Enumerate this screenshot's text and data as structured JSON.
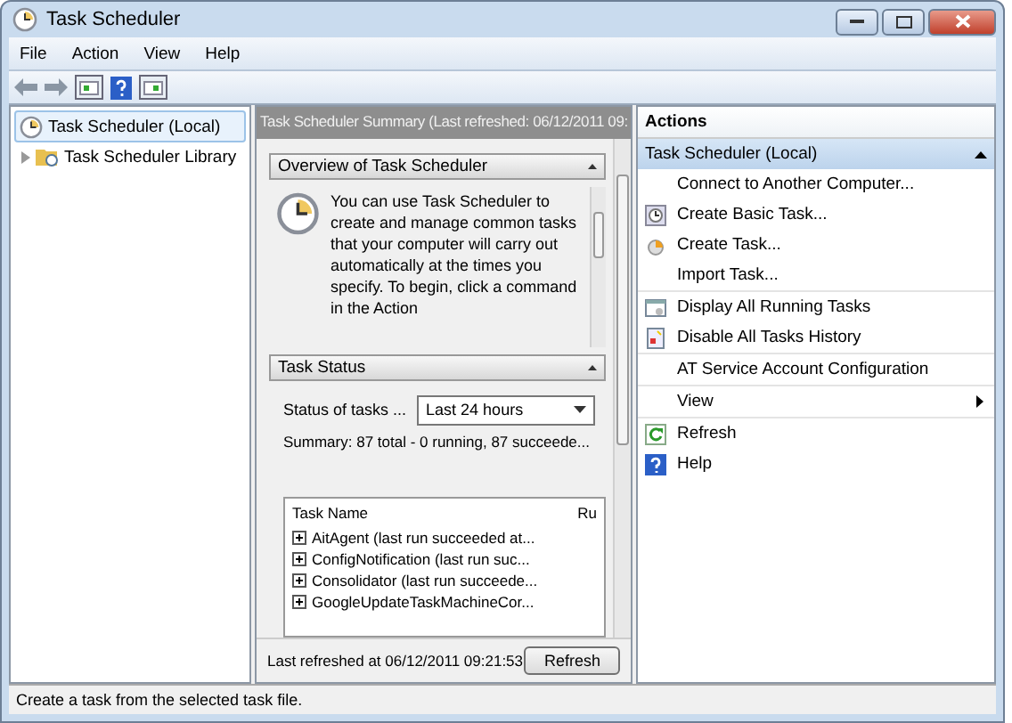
{
  "window": {
    "title": "Task Scheduler"
  },
  "menu": [
    "File",
    "Action",
    "View",
    "Help"
  ],
  "tree": [
    {
      "label": "Task Scheduler (Local)",
      "kind": "root",
      "selected": true
    },
    {
      "label": "Task Scheduler Library",
      "kind": "library",
      "selected": false
    }
  ],
  "summary": {
    "title": "Task Scheduler Summary (Last refreshed: 06/12/2011 09:",
    "overview": {
      "title": "Overview of Task Scheduler",
      "text": "You can use Task Scheduler to create and manage common tasks that your computer will carry out automatically at the times you specify. To begin, click a command in the Action"
    },
    "status": {
      "title": "Task Status",
      "filter_label": "Status of tasks ...",
      "filter_value": "Last 24 hours",
      "summary": "Summary: 87 total - 0 running, 87 succeede...",
      "columns": [
        "Task Name",
        "Ru"
      ],
      "rows": [
        "AitAgent (last run succeeded at...",
        "ConfigNotification (last run suc...",
        "Consolidator (last run succeede...",
        "GoogleUpdateTaskMachineCor..."
      ]
    },
    "last_refreshed": "Last refreshed at 06/12/2011 09:21:53",
    "refresh_button": "Refresh"
  },
  "actions": {
    "title": "Actions",
    "group": "Task Scheduler (Local)",
    "items": [
      {
        "label": "Connect to Another Computer...",
        "kind": "plain",
        "group_end": false
      },
      {
        "label": "Create Basic Task...",
        "kind": "basic",
        "group_end": false
      },
      {
        "label": "Create Task...",
        "kind": "create",
        "group_end": false
      },
      {
        "label": "Import Task...",
        "kind": "plain",
        "group_end": true
      },
      {
        "label": "Display All Running Tasks",
        "kind": "running",
        "group_end": false
      },
      {
        "label": "Disable All Tasks History",
        "kind": "history",
        "group_end": true
      },
      {
        "label": "AT Service Account Configuration",
        "kind": "plain",
        "group_end": true
      },
      {
        "label": "View",
        "kind": "submenu",
        "group_end": true
      },
      {
        "label": "Refresh",
        "kind": "refresh",
        "group_end": false
      },
      {
        "label": "Help",
        "kind": "help",
        "group_end": false
      }
    ]
  },
  "status_bar": "Create a task from the selected task file."
}
